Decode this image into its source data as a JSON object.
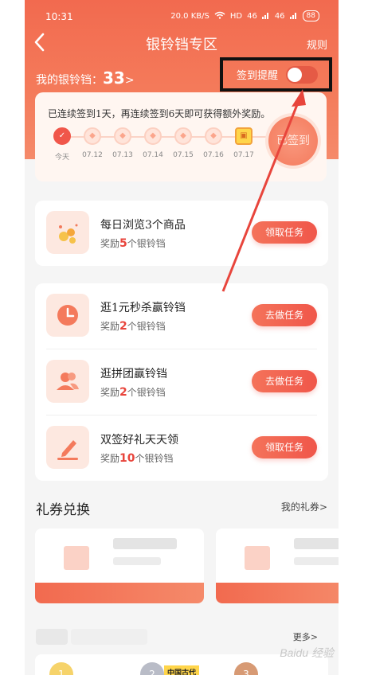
{
  "status_bar": {
    "time": "10:31",
    "network": "20.0 KB/S",
    "hd": "HD",
    "signal1": "46",
    "signal2": "46",
    "battery": "88"
  },
  "header": {
    "title": "银铃铛专区",
    "back_icon": "chevron-left-icon",
    "rules_label": "规则"
  },
  "bells": {
    "label": "我的银铃铛：",
    "count": "33",
    "arrow": ">"
  },
  "reminder": {
    "label": "签到提醒",
    "enabled": false
  },
  "checkin": {
    "message": "已连续签到1天，再连续签到6天即可获得额外奖励。",
    "days": [
      {
        "label": "今天",
        "state": "done"
      },
      {
        "label": "07.12",
        "state": "pending"
      },
      {
        "label": "07.13",
        "state": "pending"
      },
      {
        "label": "07.14",
        "state": "pending"
      },
      {
        "label": "07.15",
        "state": "pending"
      },
      {
        "label": "07.16",
        "state": "pending"
      },
      {
        "label": "07.17",
        "state": "gift"
      }
    ],
    "button_label": "已签到"
  },
  "tasks_group1": [
    {
      "title": "每日浏览3个商品",
      "reward_prefix": "奖励",
      "reward_count": "5",
      "reward_suffix": "个银铃铛",
      "button": "领取任务",
      "icon": "coins-icon"
    }
  ],
  "tasks_group2": [
    {
      "title": "逛1元秒杀赢铃铛",
      "reward_prefix": "奖励",
      "reward_count": "2",
      "reward_suffix": "个银铃铛",
      "button": "去做任务",
      "icon": "clock-icon"
    },
    {
      "title": "逛拼团赢铃铛",
      "reward_prefix": "奖励",
      "reward_count": "2",
      "reward_suffix": "个银铃铛",
      "button": "去做任务",
      "icon": "users-icon"
    },
    {
      "title": "双签好礼天天领",
      "reward_prefix": "奖励",
      "reward_count": "10",
      "reward_suffix": "个银铃铛",
      "button": "领取任务",
      "icon": "pencil-icon"
    }
  ],
  "coupons": {
    "title": "礼券兑换",
    "my_link": "我的礼券",
    "my_link_arrow": ">"
  },
  "more_section": {
    "more_label": "更多",
    "more_arrow": ">"
  },
  "books": [
    {
      "rank": "1"
    },
    {
      "rank": "2",
      "tag": "中国古代"
    },
    {
      "rank": "3"
    }
  ],
  "watermark": "Baidu 经验",
  "colors": {
    "brand": "#f26a4f",
    "accent_red": "#e8453c",
    "highlight_box": "#111111",
    "arrow": "#e8453c"
  }
}
